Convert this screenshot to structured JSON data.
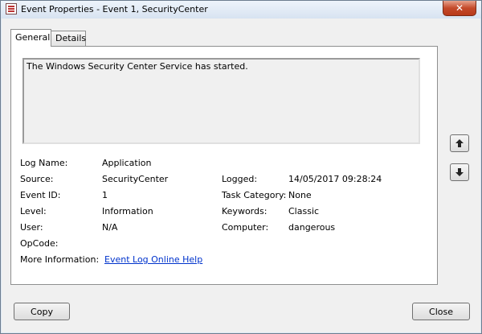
{
  "window": {
    "title": "Event Properties - Event 1, SecurityCenter",
    "close_glyph": "✕"
  },
  "tabs": [
    {
      "label": "General",
      "active": true
    },
    {
      "label": "Details",
      "active": false
    }
  ],
  "description": "The Windows Security Center Service has started.",
  "fields": {
    "log_name": {
      "label": "Log Name:",
      "value": "Application"
    },
    "source": {
      "label": "Source:",
      "value": "SecurityCenter"
    },
    "logged": {
      "label": "Logged:",
      "value": "14/05/2017 09:28:24"
    },
    "event_id": {
      "label": "Event ID:",
      "value": "1"
    },
    "task_category": {
      "label": "Task Category:",
      "value": "None"
    },
    "level": {
      "label": "Level:",
      "value": "Information"
    },
    "keywords": {
      "label": "Keywords:",
      "value": "Classic"
    },
    "user": {
      "label": "User:",
      "value": "N/A"
    },
    "computer": {
      "label": "Computer:",
      "value": "dangerous"
    },
    "opcode": {
      "label": "OpCode:",
      "value": ""
    },
    "more_info": {
      "label": "More Information:",
      "link": "Event Log Online Help"
    }
  },
  "buttons": {
    "copy": "Copy",
    "close": "Close"
  },
  "icons": {
    "prev": "arrow-up-icon",
    "next": "arrow-down-icon"
  }
}
